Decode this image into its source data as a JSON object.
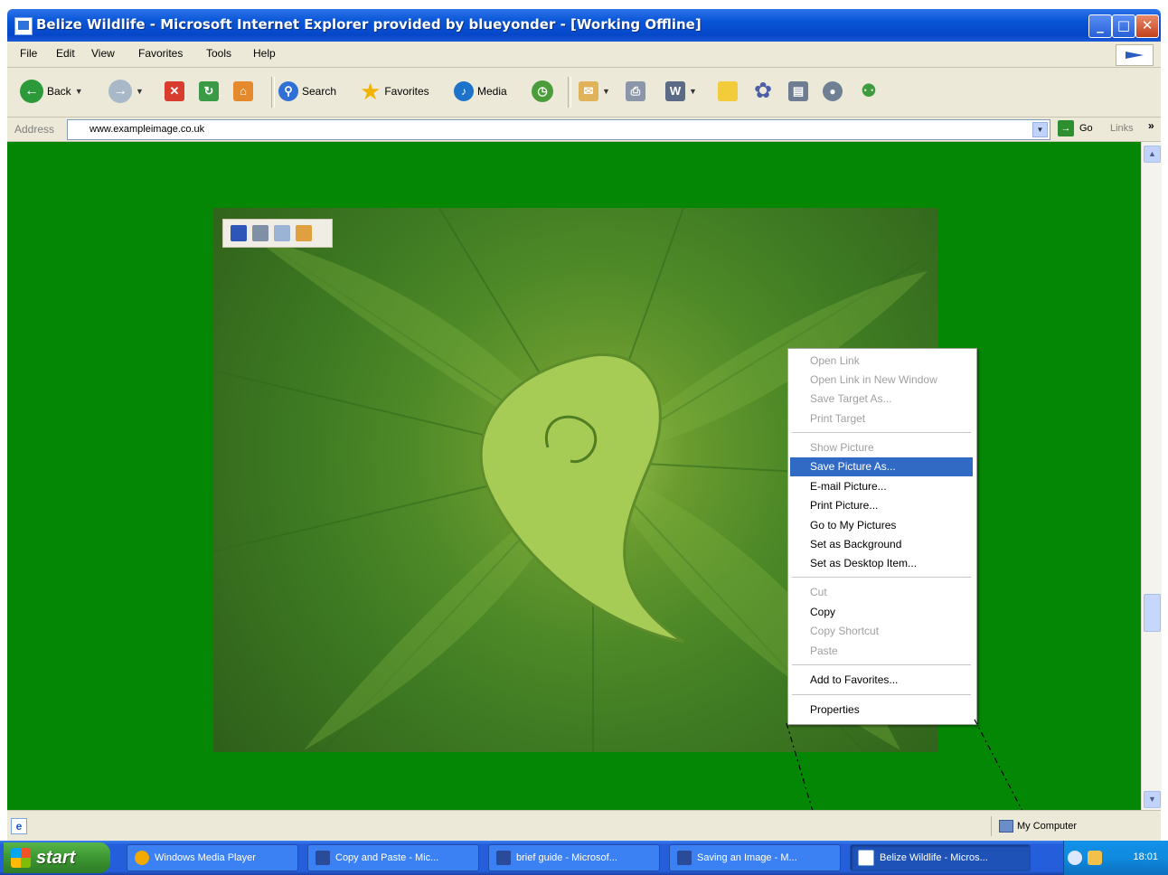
{
  "window": {
    "title": "Belize Wildlife - Microsoft Internet Explorer provided by blueyonder - [Working Offline]",
    "controls": [
      "_",
      "□",
      "✕"
    ]
  },
  "menubar": [
    "File",
    "Edit",
    "View",
    "Favorites",
    "Tools",
    "Help"
  ],
  "toolbar": {
    "back": "Back",
    "search": "Search",
    "favorites": "Favorites",
    "media": "Media"
  },
  "address": {
    "label": "Address",
    "value": "www.exampleimage.co.uk",
    "go": "Go",
    "links": "Links"
  },
  "context_menu": {
    "groups": [
      [
        {
          "label": "Open Link",
          "enabled": false
        },
        {
          "label": "Open Link in New Window",
          "enabled": false
        },
        {
          "label": "Save Target As...",
          "enabled": false
        },
        {
          "label": "Print Target",
          "enabled": false
        }
      ],
      [
        {
          "label": "Show Picture",
          "enabled": false
        },
        {
          "label": "Save Picture As...",
          "enabled": true,
          "selected": true
        },
        {
          "label": "E-mail Picture...",
          "enabled": true
        },
        {
          "label": "Print Picture...",
          "enabled": true
        },
        {
          "label": "Go to My Pictures",
          "enabled": true
        },
        {
          "label": "Set as Background",
          "enabled": true
        },
        {
          "label": "Set as Desktop Item...",
          "enabled": true
        }
      ],
      [
        {
          "label": "Cut",
          "enabled": false
        },
        {
          "label": "Copy",
          "enabled": true
        },
        {
          "label": "Copy Shortcut",
          "enabled": false
        },
        {
          "label": "Paste",
          "enabled": false
        }
      ],
      [
        {
          "label": "Add to Favorites...",
          "enabled": true
        }
      ],
      [
        {
          "label": "Properties",
          "enabled": true
        }
      ]
    ]
  },
  "statusbar": {
    "zone": "My Computer"
  },
  "taskbar": {
    "start": "start",
    "tasks": [
      {
        "label": "Windows Media Player",
        "active": false
      },
      {
        "label": "Copy and Paste - Mic...",
        "active": false
      },
      {
        "label": "brief guide - Microsof...",
        "active": false
      },
      {
        "label": "Saving an Image - M...",
        "active": false
      },
      {
        "label": "Belize Wildlife - Micros...",
        "active": true
      }
    ],
    "clock": "18:01"
  },
  "colors": {
    "page_background": "#048704",
    "titlebar": "#0a57d8",
    "menu_highlight": "#316ac5",
    "taskbar": "#245edb",
    "start_button": "#3c9632"
  }
}
